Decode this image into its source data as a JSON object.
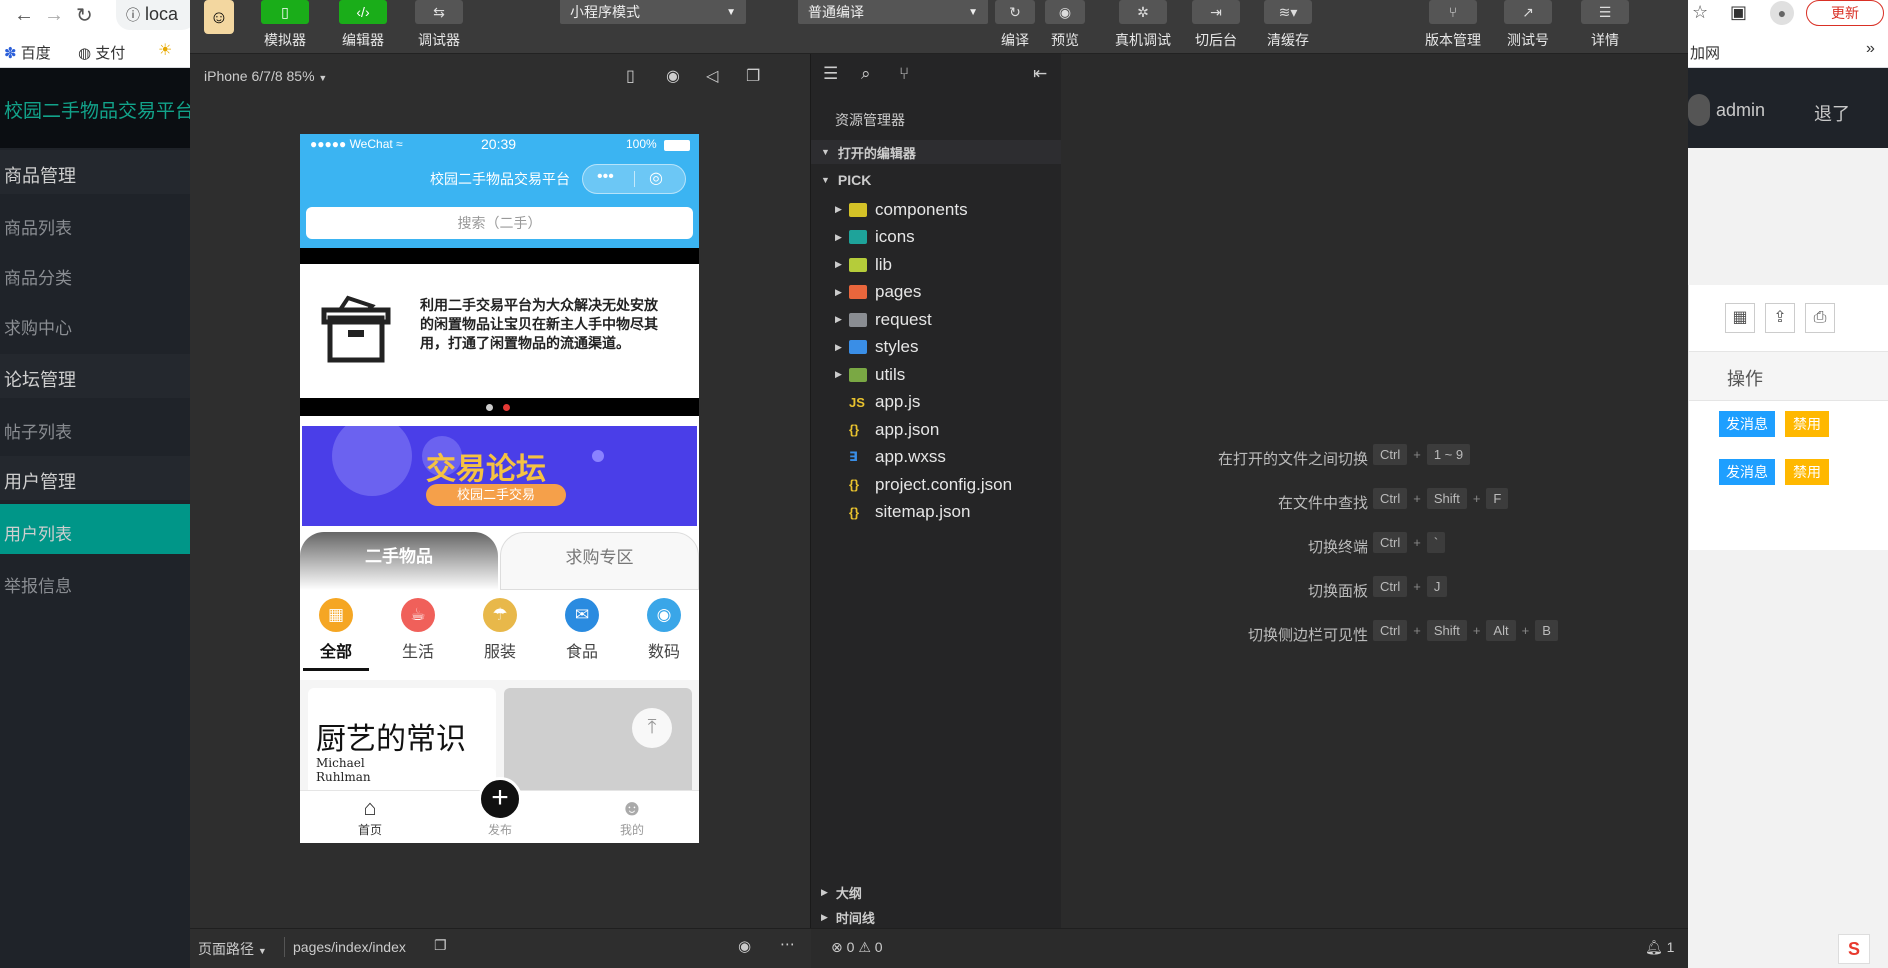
{
  "browser": {
    "url": "loca",
    "update_button": "更新",
    "bookmarks": [
      "百度",
      "支付"
    ],
    "bookmark_right": "加网"
  },
  "admin_app": {
    "title": "校园二手物品交易平台",
    "user": "admin",
    "logout": "退了",
    "menu": [
      {
        "label": "商品管理",
        "type": "group"
      },
      {
        "label": "商品列表",
        "type": "item"
      },
      {
        "label": "商品分类",
        "type": "item"
      },
      {
        "label": "求购中心",
        "type": "item"
      },
      {
        "label": "论坛管理",
        "type": "group"
      },
      {
        "label": "帖子列表",
        "type": "item"
      },
      {
        "label": "用户管理",
        "type": "group"
      },
      {
        "label": "用户列表",
        "type": "active"
      },
      {
        "label": "举报信息",
        "type": "item"
      }
    ],
    "table_header_action": "操作",
    "row_actions": [
      {
        "message": "发消息",
        "disable": "禁用"
      },
      {
        "message": "发消息",
        "disable": "禁用"
      }
    ]
  },
  "toolbar": {
    "simulator": "模拟器",
    "editor": "编辑器",
    "debugger": "调试器",
    "mode_select": "小程序模式",
    "compile_select": "普通编译",
    "compile": "编译",
    "preview": "预览",
    "remote_debug": "真机调试",
    "background": "切后台",
    "clear_cache": "清缓存",
    "version": "版本管理",
    "test_account": "测试号",
    "details": "详情"
  },
  "simulator": {
    "device": "iPhone 6/7/8 85%",
    "page_path_label": "页面路径",
    "page_path": "pages/index/index"
  },
  "phone": {
    "carrier": "●●●●● WeChat",
    "time": "20:39",
    "battery": "100%",
    "nav_title": "校园二手物品交易平台",
    "search_placeholder": "搜索（二手）",
    "swiper_text": "利用二手交易平台为大众解决无处安放的闲置物品让宝贝在新主人手中物尽其用，打通了闲置物品的流通渠道。",
    "banner_title": "交易论坛",
    "banner_sub": "校园二手交易",
    "tab_active": "二手物品",
    "tab_other": "求购专区",
    "categories": [
      {
        "label": "全部",
        "color": "#f5a623",
        "glyph": "▦"
      },
      {
        "label": "生活",
        "color": "#f0605a",
        "glyph": "☕"
      },
      {
        "label": "服装",
        "color": "#e8b84a",
        "glyph": "☂"
      },
      {
        "label": "食品",
        "color": "#2a8be0",
        "glyph": "✉"
      },
      {
        "label": "数码",
        "color": "#3aa6e8",
        "glyph": "◉"
      }
    ],
    "book_title": "厨艺的常识",
    "book_author": "Michael Ruhlman",
    "tabbar": {
      "home": "首页",
      "publish": "发布",
      "mine": "我的"
    }
  },
  "explorer": {
    "title": "资源管理器",
    "open_editors": "打开的编辑器",
    "project": "PICK",
    "items": [
      {
        "name": "components",
        "kind": "folder",
        "color": "#d4c227"
      },
      {
        "name": "icons",
        "kind": "folder",
        "color": "#1ea39a"
      },
      {
        "name": "lib",
        "kind": "folder",
        "color": "#b5cc3a"
      },
      {
        "name": "pages",
        "kind": "folder",
        "color": "#e9663c"
      },
      {
        "name": "request",
        "kind": "folder",
        "color": "#8a8d92"
      },
      {
        "name": "styles",
        "kind": "folder",
        "color": "#3a8ee6"
      },
      {
        "name": "utils",
        "kind": "folder",
        "color": "#7aa844"
      },
      {
        "name": "app.js",
        "kind": "js",
        "color": "#e8c22e"
      },
      {
        "name": "app.json",
        "kind": "json",
        "color": "#e8c22e"
      },
      {
        "name": "app.wxss",
        "kind": "wxss",
        "color": "#3a8ee6"
      },
      {
        "name": "project.config.json",
        "kind": "json",
        "color": "#e8c22e"
      },
      {
        "name": "sitemap.json",
        "kind": "json",
        "color": "#e8c22e"
      }
    ],
    "outline": "大纲",
    "timeline": "时间线",
    "errors": "0",
    "warnings": "0",
    "notifications": "1"
  },
  "shortcuts": [
    {
      "label": "在打开的文件之间切换",
      "keys": [
        "Ctrl",
        "1 ~ 9"
      ]
    },
    {
      "label": "在文件中查找",
      "keys": [
        "Ctrl",
        "Shift",
        "F"
      ]
    },
    {
      "label": "切换终端",
      "keys": [
        "Ctrl",
        "`"
      ]
    },
    {
      "label": "切换面板",
      "keys": [
        "Ctrl",
        "J"
      ]
    },
    {
      "label": "切换侧边栏可见性",
      "keys": [
        "Ctrl",
        "Shift",
        "Alt",
        "B"
      ]
    }
  ]
}
